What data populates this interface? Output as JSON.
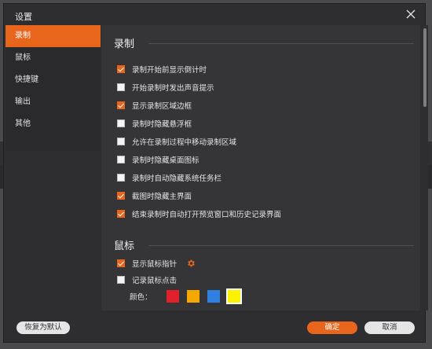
{
  "dialog": {
    "title": "设置"
  },
  "sidebar": {
    "items": [
      {
        "label": "录制",
        "active": true
      },
      {
        "label": "鼠标",
        "active": false
      },
      {
        "label": "快捷键",
        "active": false
      },
      {
        "label": "输出",
        "active": false
      },
      {
        "label": "其他",
        "active": false
      }
    ]
  },
  "recording": {
    "title": "录制",
    "options": [
      {
        "label": "录制开始前显示倒计时",
        "checked": true
      },
      {
        "label": "开始录制时发出声音提示",
        "checked": false
      },
      {
        "label": "显示录制区域边框",
        "checked": true
      },
      {
        "label": "录制时隐藏悬浮框",
        "checked": false
      },
      {
        "label": "允许在录制过程中移动录制区域",
        "checked": false
      },
      {
        "label": "录制时隐藏桌面图标",
        "checked": false
      },
      {
        "label": "录制时自动隐藏系统任务栏",
        "checked": false
      },
      {
        "label": "截图时隐藏主界面",
        "checked": true
      },
      {
        "label": "结束录制时自动打开预览窗口和历史记录界面",
        "checked": true
      }
    ]
  },
  "mouse": {
    "title": "鼠标",
    "show_cursor": {
      "label": "显示鼠标指针",
      "checked": true
    },
    "record_clicks": {
      "label": "记录鼠标点击",
      "checked": false
    },
    "color_label": "颜色：",
    "colors": [
      "#e0202a",
      "#f5a800",
      "#2f80e0",
      "#fff200"
    ],
    "selected_color": "#fff200"
  },
  "footer": {
    "reset_label": "恢复为默认",
    "ok_label": "确定",
    "cancel_label": "取消"
  },
  "theme": {
    "accent": "#e8651c"
  }
}
